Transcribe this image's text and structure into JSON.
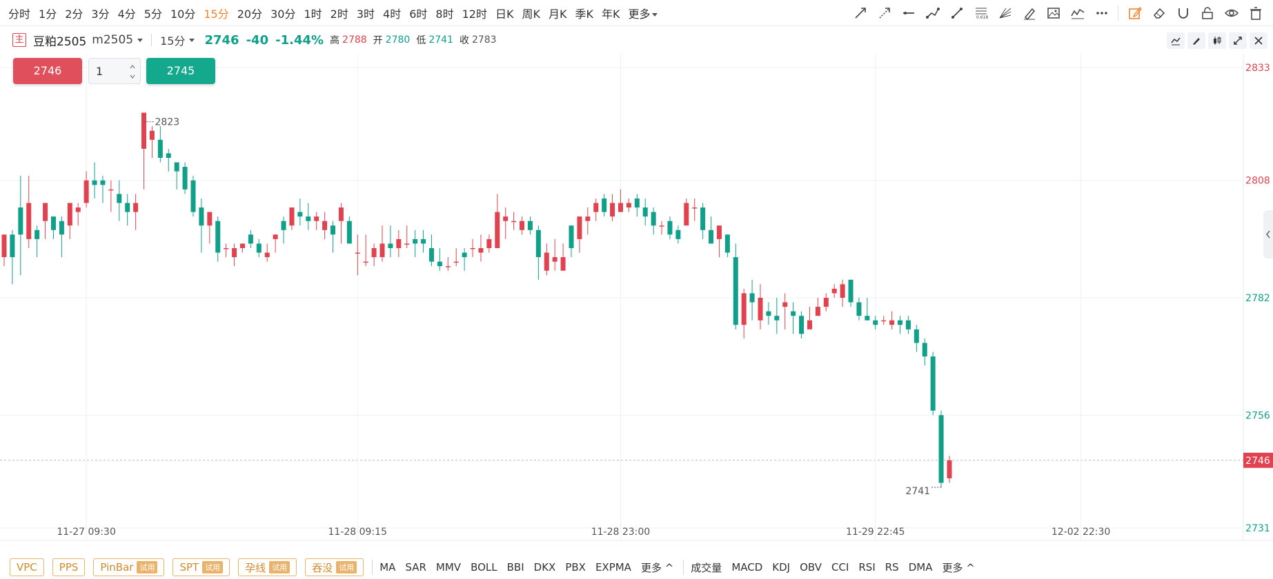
{
  "periods": [
    "分时",
    "1分",
    "2分",
    "3分",
    "4分",
    "5分",
    "10分",
    "15分",
    "20分",
    "30分",
    "1时",
    "2时",
    "3时",
    "4时",
    "6时",
    "8时",
    "12时",
    "日K",
    "周K",
    "月K",
    "季K",
    "年K"
  ],
  "active_period": "15分",
  "more_label": "更多",
  "header": {
    "tag": "主",
    "symbol": "豆粕2505",
    "contract": "m2505",
    "interval": "15分",
    "last": "2746",
    "change": "-40",
    "change_pct": "-1.44%",
    "high_label": "高",
    "high": "2788",
    "open_label": "开",
    "open": "2780",
    "low_label": "低",
    "low": "2741",
    "close_label": "收",
    "close": "2783"
  },
  "trade": {
    "sell_price": "2746",
    "quantity": "1",
    "buy_price": "2745"
  },
  "colors": {
    "up": "#e0424f",
    "down": "#10a08a",
    "accent": "#f0842c",
    "grid": "#eef0f3"
  },
  "chart_data": {
    "type": "candlestick",
    "ylim": [
      2731,
      2833
    ],
    "y_ticks": [
      "2833",
      "2808",
      "2782",
      "2756",
      "2746",
      "2731"
    ],
    "x_ticks": [
      "11-27 09:30",
      "11-28 09:15",
      "11-28 23:00",
      "11-29 22:45",
      "12-02 22:30"
    ],
    "last_price": "2746",
    "max_label": "2823",
    "min_label": "2741",
    "candles": [
      [
        2791,
        2796,
        2789,
        2792
      ],
      [
        2796,
        2791,
        2785,
        2797
      ],
      [
        2802,
        2796,
        2787,
        2809
      ],
      [
        2795,
        2803,
        2793,
        2809
      ],
      [
        2797,
        2795,
        2791,
        2798
      ],
      [
        2799,
        2803,
        2795,
        2803
      ],
      [
        2800,
        2797,
        2795,
        2800
      ],
      [
        2799,
        2796,
        2791,
        2800
      ],
      [
        2798,
        2803,
        2795,
        2803
      ],
      [
        2801,
        2802,
        2798,
        2803
      ],
      [
        2803,
        2808,
        2802,
        2810
      ],
      [
        2808,
        2807,
        2804,
        2812
      ],
      [
        2808,
        2807,
        2803,
        2809
      ],
      [
        2806,
        2806,
        2801,
        2808
      ],
      [
        2805,
        2803,
        2799,
        2808
      ],
      [
        2803,
        2801,
        2798,
        2805
      ],
      [
        2801,
        2803,
        2797,
        2805
      ],
      [
        2815,
        2823,
        2806,
        2821
      ],
      [
        2817,
        2819,
        2813,
        2820
      ],
      [
        2817,
        2813,
        2812,
        2820
      ],
      [
        2814,
        2813,
        2810,
        2815
      ],
      [
        2812,
        2810,
        2806,
        2812
      ],
      [
        2811,
        2806,
        2805,
        2812
      ],
      [
        2808,
        2801,
        2800,
        2809
      ],
      [
        2802,
        2798,
        2792,
        2804
      ],
      [
        2798,
        2801,
        2794,
        2801
      ],
      [
        2799,
        2792,
        2790,
        2800
      ],
      [
        2793,
        2793,
        2791,
        2794
      ],
      [
        2791,
        2793,
        2789,
        2794
      ],
      [
        2793,
        2794,
        2792,
        2794
      ],
      [
        2796,
        2794,
        2793,
        2797
      ],
      [
        2794,
        2792,
        2791,
        2795
      ],
      [
        2791,
        2792,
        2790,
        2794
      ],
      [
        2795,
        2796,
        2792,
        2796
      ],
      [
        2799,
        2797,
        2794,
        2800
      ],
      [
        2798,
        2802,
        2797,
        2802
      ],
      [
        2801,
        2800,
        2798,
        2804
      ],
      [
        2800,
        2799,
        2797,
        2803
      ],
      [
        2799,
        2800,
        2797,
        2801
      ],
      [
        2797,
        2799,
        2795,
        2801
      ],
      [
        2798,
        2796,
        2792,
        2799
      ],
      [
        2799,
        2802,
        2794,
        2803
      ],
      [
        2799,
        2794,
        2794,
        2800
      ],
      [
        2792,
        2792,
        2787,
        2796
      ],
      [
        2790,
        2790,
        2789,
        2796
      ],
      [
        2791,
        2793,
        2789,
        2794
      ],
      [
        2791,
        2794,
        2790,
        2798
      ],
      [
        2794,
        2793,
        2791,
        2798
      ],
      [
        2793,
        2795,
        2791,
        2797
      ],
      [
        2794,
        2794,
        2793,
        2798
      ],
      [
        2795,
        2794,
        2791,
        2797
      ],
      [
        2795,
        2794,
        2792,
        2797
      ],
      [
        2793,
        2790,
        2789,
        2796
      ],
      [
        2790,
        2789,
        2788,
        2793
      ],
      [
        2789,
        2789,
        2788,
        2791
      ],
      [
        2790,
        2790,
        2789,
        2793
      ],
      [
        2792,
        2791,
        2788,
        2793
      ],
      [
        2793,
        2793,
        2791,
        2795
      ],
      [
        2792,
        2793,
        2790,
        2796
      ],
      [
        2793,
        2795,
        2792,
        2796
      ],
      [
        2793,
        2801,
        2793,
        2805
      ],
      [
        2799,
        2800,
        2795,
        2802
      ],
      [
        2799,
        2799,
        2797,
        2801
      ],
      [
        2797,
        2799,
        2796,
        2800
      ],
      [
        2799,
        2797,
        2796,
        2800
      ],
      [
        2797,
        2791,
        2786,
        2798
      ],
      [
        2788,
        2792,
        2787,
        2794
      ],
      [
        2790,
        2791,
        2788,
        2795
      ],
      [
        2788,
        2791,
        2789,
        2794
      ],
      [
        2798,
        2793,
        2791,
        2798
      ],
      [
        2795,
        2800,
        2792,
        2800
      ],
      [
        2799,
        2800,
        2796,
        2802
      ],
      [
        2801,
        2803,
        2799,
        2804
      ],
      [
        2804,
        2801,
        2800,
        2805
      ],
      [
        2800,
        2803,
        2799,
        2805
      ],
      [
        2801,
        2803,
        2801,
        2806
      ],
      [
        2802,
        2803,
        2801,
        2804
      ],
      [
        2804,
        2802,
        2800,
        2805
      ],
      [
        2802,
        2800,
        2798,
        2804
      ],
      [
        2801,
        2798,
        2796,
        2802
      ],
      [
        2798,
        2798,
        2796,
        2799
      ],
      [
        2799,
        2796,
        2795,
        2800
      ],
      [
        2797,
        2795,
        2794,
        2798
      ],
      [
        2798,
        2803,
        2799,
        2804
      ],
      [
        2802,
        2802,
        2799,
        2804
      ],
      [
        2802,
        2797,
        2795,
        2803
      ],
      [
        2797,
        2794,
        2794,
        2800
      ],
      [
        2795,
        2798,
        2791,
        2798
      ],
      [
        2796,
        2792,
        2791,
        2796
      ],
      [
        2791,
        2776,
        2775,
        2794
      ],
      [
        2776,
        2783,
        2773,
        2784
      ],
      [
        2783,
        2781,
        2777,
        2786
      ],
      [
        2777,
        2782,
        2775,
        2785
      ],
      [
        2779,
        2778,
        2776,
        2781
      ],
      [
        2778,
        2777,
        2774,
        2782
      ],
      [
        2780,
        2781,
        2775,
        2783
      ],
      [
        2779,
        2778,
        2774,
        2781
      ],
      [
        2778,
        2774,
        2773,
        2779
      ],
      [
        2775,
        2777,
        2776,
        2780
      ],
      [
        2778,
        2780,
        2778,
        2782
      ],
      [
        2780,
        2782,
        2779,
        2783
      ],
      [
        2783,
        2784,
        2782,
        2785
      ],
      [
        2782,
        2785,
        2780,
        2786
      ],
      [
        2786,
        2781,
        2780,
        2786
      ],
      [
        2781,
        2778,
        2777,
        2782
      ],
      [
        2778,
        2777,
        2777,
        2782
      ],
      [
        2777,
        2776,
        2775,
        2778
      ],
      [
        2777,
        2777,
        2776,
        2778
      ],
      [
        2776,
        2777,
        2775,
        2779
      ],
      [
        2777,
        2776,
        2774,
        2778
      ],
      [
        2777,
        2775,
        2774,
        2778
      ],
      [
        2775,
        2772,
        2770,
        2776
      ],
      [
        2772,
        2769,
        2767,
        2773
      ],
      [
        2769,
        2757,
        2756,
        2770
      ],
      [
        2756,
        2741,
        2740,
        2757
      ],
      [
        2742,
        2746,
        2741,
        2747
      ]
    ]
  },
  "bottom": {
    "boxes": [
      {
        "label": "VPC",
        "trial": ""
      },
      {
        "label": "PPS",
        "trial": ""
      },
      {
        "label": "PinBar",
        "trial": "试用"
      },
      {
        "label": "SPT",
        "trial": "试用"
      },
      {
        "label": "孕线",
        "trial": "试用"
      },
      {
        "label": "吞没",
        "trial": "试用"
      }
    ],
    "main_indicators": [
      "MA",
      "SAR",
      "MMV",
      "BOLL",
      "BBI",
      "DKX",
      "PBX",
      "EXPMA"
    ],
    "sub_indicators": [
      "成交量",
      "MACD",
      "KDJ",
      "OBV",
      "CCI",
      "RSI",
      "RS",
      "DMA"
    ],
    "more_label": "更多"
  }
}
